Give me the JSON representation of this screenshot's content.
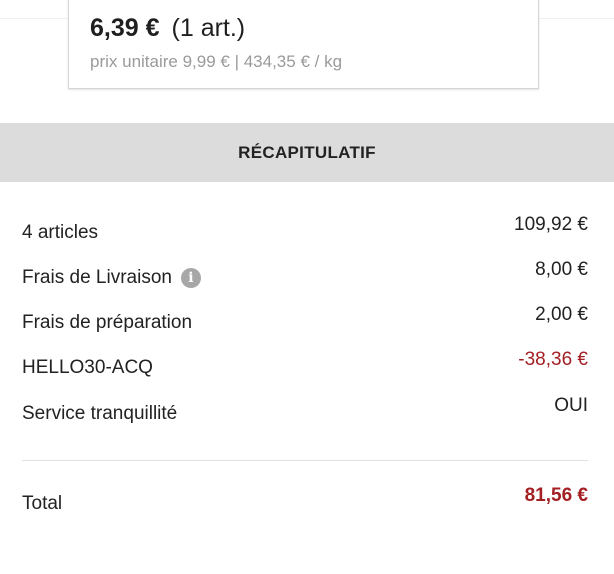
{
  "product": {
    "price": "6,39 €",
    "quantity": "(1 art.)",
    "unit_price": "prix unitaire 9,99 € | 434,35 € / kg"
  },
  "recap": {
    "title": "RÉCAPITULATIF",
    "rows": [
      {
        "label": "4 articles",
        "value": "109,92 €"
      },
      {
        "label": "Frais de Livraison",
        "value": "8,00 €",
        "icon": "info-icon"
      },
      {
        "label": "Frais de préparation",
        "value": "2,00 €"
      },
      {
        "label": "HELLO30-ACQ",
        "value": "-38,36 €"
      },
      {
        "label": "Service tranquillité",
        "value": "OUI"
      }
    ],
    "total": {
      "label": "Total",
      "value": "81,56 €"
    }
  },
  "colors": {
    "accent": "#2f9a7a",
    "discount": "#a31f24",
    "header_bg": "#dcdcdc",
    "muted_text": "#9a9a9a"
  }
}
